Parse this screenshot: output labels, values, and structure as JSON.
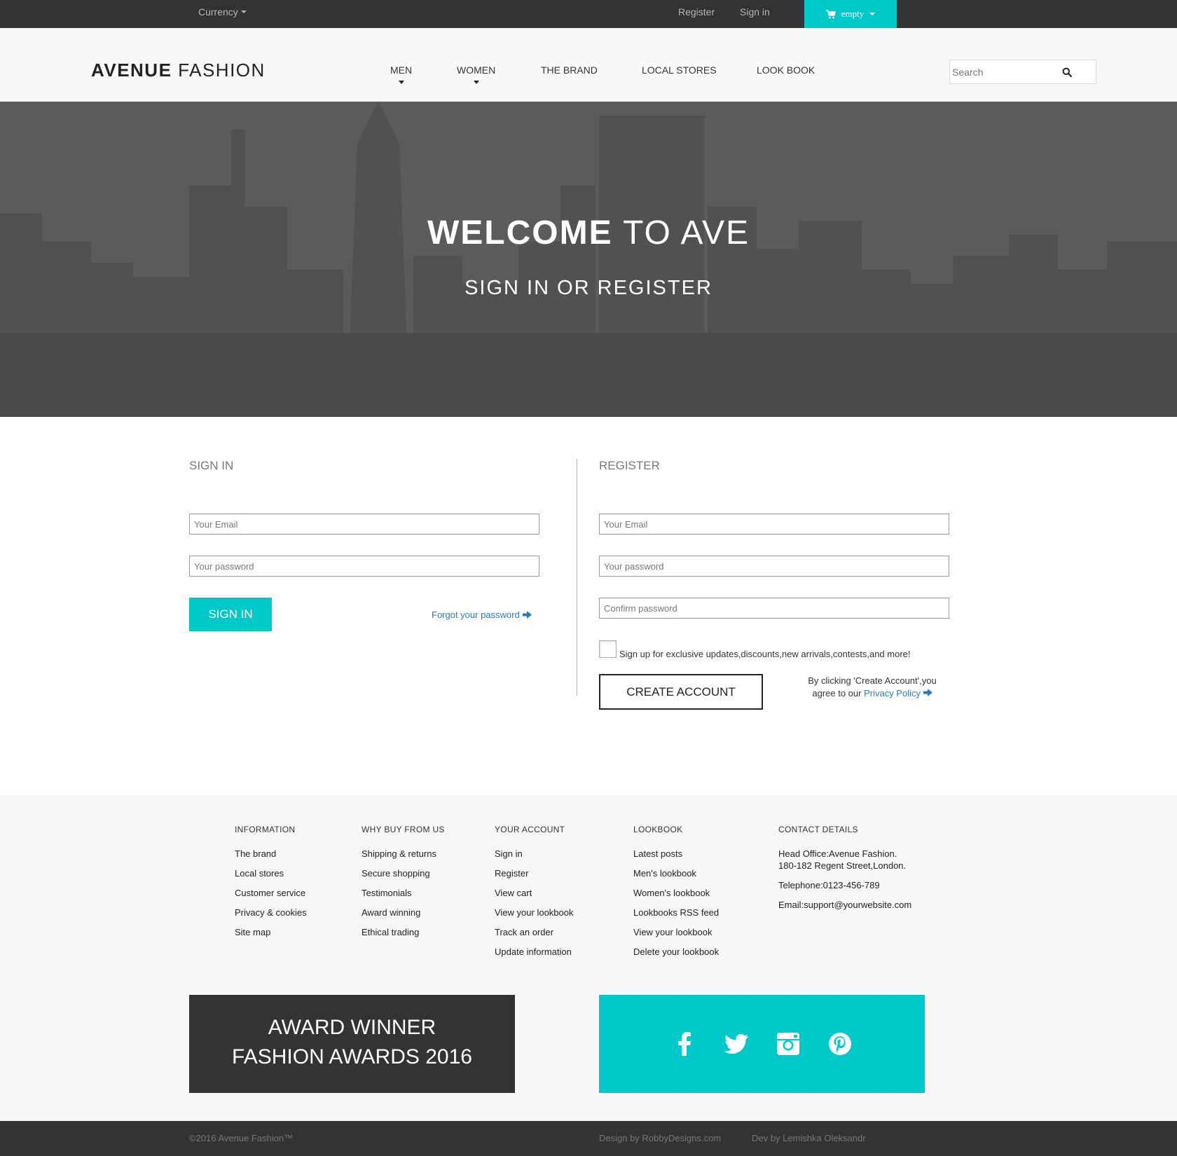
{
  "topbar": {
    "currency_label": "Currency",
    "register_label": "Register",
    "signin_label": "Sign in",
    "cart_label": "empty",
    "cart_color": "#00c8c8"
  },
  "header": {
    "logo_bold": "AVENUE",
    "logo_light": "FASHION",
    "nav": [
      "MEN",
      "WOMEN",
      "THE BRAND",
      "LOCAL STORES",
      "LOOK BOOK"
    ],
    "search_placeholder": "Search"
  },
  "hero": {
    "title_bold": "WELCOME",
    "title_light": "TO AVE",
    "subtitle": "SIGN IN OR REGISTER"
  },
  "signin": {
    "title": "SIGN IN",
    "email_placeholder": "Your Email",
    "password_placeholder": "Your password",
    "button": "SIGN IN",
    "forgot": "Forgot your password"
  },
  "register": {
    "title": "REGISTER",
    "email_placeholder": "Your Email",
    "password_placeholder": "Your password",
    "confirm_placeholder": "Confirm password",
    "signup_text": "Sign up for exclusive updates,discounts,new arrivals,contests,and more!",
    "button": "CREATE ACCOUNT",
    "agree_line1": "By clicking 'Create Account',you",
    "agree_line2": "agree to our ",
    "privacy_link": "Privacy Policy"
  },
  "footer": {
    "columns": [
      {
        "heading": "INFORMATION",
        "links": [
          "The brand",
          "Local stores",
          "Customer service",
          "Privacy & cookies",
          "Site map"
        ]
      },
      {
        "heading": "WHY BUY FROM US",
        "links": [
          "Shipping & returns",
          "Secure shopping",
          "Testimonials",
          "Award winning",
          "Ethical trading"
        ]
      },
      {
        "heading": "YOUR ACCOUNT",
        "links": [
          "Sign in",
          "Register",
          "View cart",
          "View your lookbook",
          "Track an order",
          "Update information"
        ]
      },
      {
        "heading": "LOOKBOOK",
        "links": [
          "Latest posts",
          "Men's lookbook",
          "Women's lookbook",
          "Lookbooks RSS feed",
          "View your lookbook",
          "Delete your lookbook"
        ]
      }
    ],
    "contact": {
      "heading": "CONTACT DETAILS",
      "office_line1": "Head Office:Avenue Fashion.",
      "office_line2": "180-182 Regent Street,London.",
      "telephone": "Telephone:0123-456-789",
      "email": "Email:support@yourwebsite.com"
    },
    "award_line1": "AWARD WINNER",
    "award_line2": "FASHION AWARDS 2016",
    "social_icons": [
      "facebook-icon",
      "twitter-icon",
      "instagram-icon",
      "pinterest-icon"
    ]
  },
  "bottombar": {
    "copyright": "©2016 Avenue Fashion™",
    "design": "Design by RobbyDesigns.com",
    "dev": "Dev by Lemishka Oleksandr"
  }
}
